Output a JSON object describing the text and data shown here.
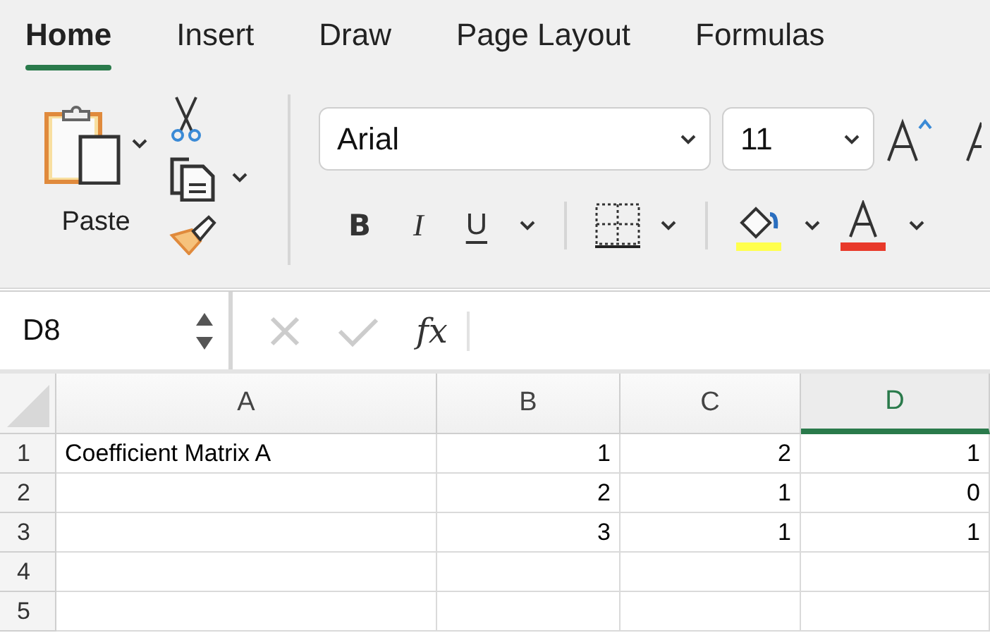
{
  "tabs": [
    {
      "label": "Home",
      "selected": true
    },
    {
      "label": "Insert",
      "selected": false
    },
    {
      "label": "Draw",
      "selected": false
    },
    {
      "label": "Page Layout",
      "selected": false
    },
    {
      "label": "Formulas",
      "selected": false
    }
  ],
  "clipboard": {
    "paste_label": "Paste"
  },
  "font": {
    "name": "Arial",
    "size": "11"
  },
  "format_buttons": [
    {
      "label": "B",
      "kind": "bold"
    },
    {
      "label": "I",
      "kind": "italic"
    },
    {
      "label": "U",
      "kind": "underline"
    }
  ],
  "formula_bar": {
    "name_box": "D8",
    "function_label": "fx"
  },
  "sheet": {
    "columns": [
      {
        "label": "A",
        "selected": false
      },
      {
        "label": "B",
        "selected": false
      },
      {
        "label": "C",
        "selected": false
      },
      {
        "label": "D",
        "selected": true
      }
    ],
    "rows": [
      {
        "number": "1",
        "cells": [
          "Coefficient Matrix A",
          "1",
          "2",
          "1"
        ]
      },
      {
        "number": "2",
        "cells": [
          null,
          "2",
          "1",
          "0"
        ]
      },
      {
        "number": "3",
        "cells": [
          null,
          "3",
          "1",
          "1"
        ]
      },
      {
        "number": "4",
        "cells": [
          null,
          null,
          null,
          null
        ]
      },
      {
        "number": "5",
        "cells": [
          null,
          null,
          null,
          null
        ]
      }
    ]
  }
}
